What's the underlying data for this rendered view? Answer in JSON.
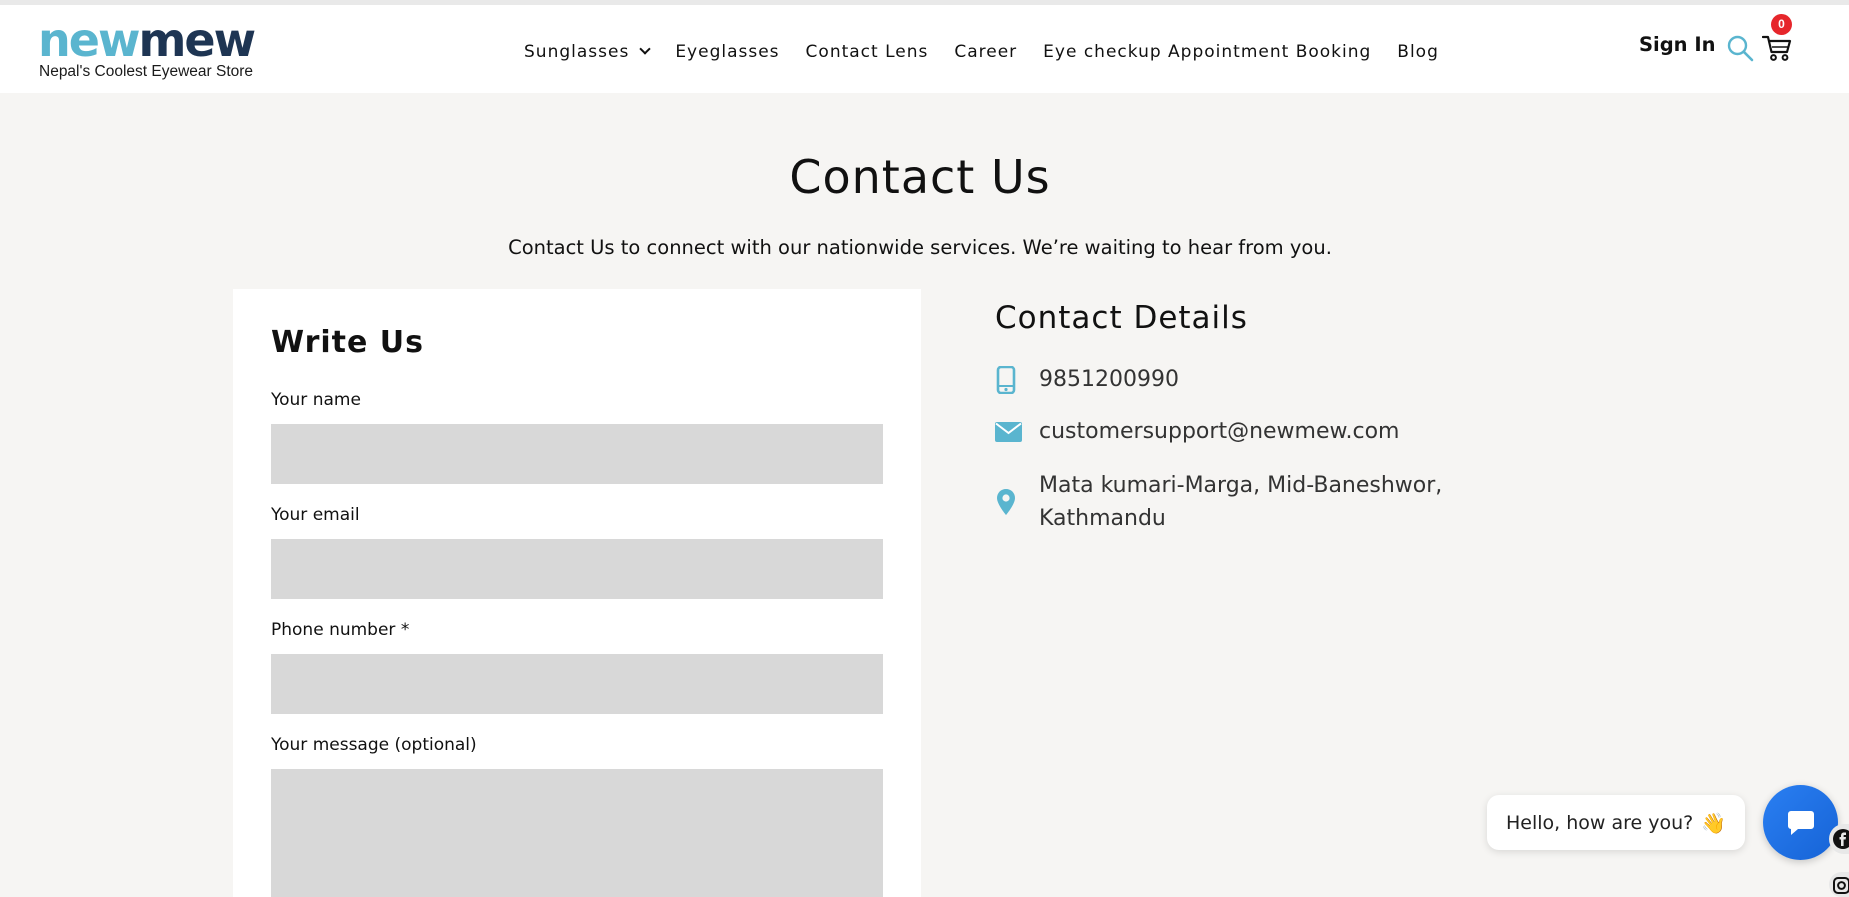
{
  "header": {
    "logo_part1": "new",
    "logo_part2": "mew",
    "logo_tagline": "Nepal's Coolest Eyewear Store",
    "nav": [
      {
        "label": "Sunglasses"
      },
      {
        "label": "Eyeglasses"
      },
      {
        "label": "Contact Lens"
      },
      {
        "label": "Career"
      },
      {
        "label": "Eye checkup Appointment Booking"
      },
      {
        "label": "Blog"
      }
    ],
    "sign_in": "Sign In",
    "cart_count": "0",
    "icons": {
      "search": "search-icon",
      "cart": "cart-icon",
      "dropdown": "chevron-down-icon"
    }
  },
  "page": {
    "title": "Contact Us",
    "subtitle": "Contact Us to connect with our nationwide services. We’re waiting to hear from you."
  },
  "form": {
    "title": "Write Us",
    "fields": [
      {
        "label": "Your name",
        "value": ""
      },
      {
        "label": "Your email",
        "value": ""
      },
      {
        "label": "Phone number *",
        "value": ""
      },
      {
        "label": "Your message (optional)",
        "value": ""
      }
    ]
  },
  "contact": {
    "title": "Contact Details",
    "phone": "9851200990",
    "email": "customersupport@newmew.com",
    "address_line1": "Mata kumari-Marga, Mid-Baneshwor,",
    "address_line2": "Kathmandu",
    "icons": {
      "phone": "mobile-phone-icon",
      "email": "envelope-icon",
      "address": "map-pin-icon"
    }
  },
  "chat": {
    "greeting": "Hello, how are you?",
    "icons": {
      "wave": "waving-hand-icon",
      "button": "chat-bubble-icon"
    }
  },
  "colors": {
    "accent": "#5ab5cf",
    "brand_dark": "#1e3553",
    "page_bg": "#f6f5f3",
    "input_bg": "#d8d8d8",
    "badge": "#e6262b",
    "chat_button": "#1f73e6"
  }
}
